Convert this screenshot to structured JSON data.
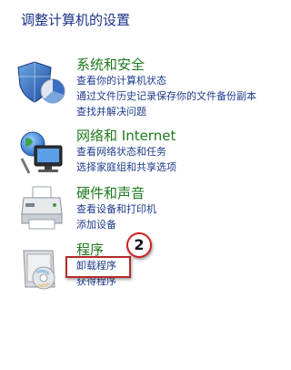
{
  "page_title": "调整计算机的设置",
  "categories": [
    {
      "title": "系统和安全",
      "icon": "security-shield-icon",
      "links": [
        "查看你的计算机状态",
        "通过文件历史记录保存你的文件备份副本",
        "查找并解决问题"
      ]
    },
    {
      "title": "网络和 Internet",
      "icon": "network-icon",
      "links": [
        "查看网络状态和任务",
        "选择家庭组和共享选项"
      ]
    },
    {
      "title": "硬件和声音",
      "icon": "printer-icon",
      "links": [
        "查看设备和打印机",
        "添加设备"
      ]
    },
    {
      "title": "程序",
      "icon": "programs-icon",
      "links": [
        "卸载程序",
        "获得程序"
      ]
    }
  ],
  "annotation": {
    "step_number": "2",
    "highlighted_link": "卸载程序",
    "marker_color": "#cc2222"
  },
  "colors": {
    "heading": "#1e3287",
    "category_title": "#1e7a1e",
    "link": "#1e3c8c"
  }
}
